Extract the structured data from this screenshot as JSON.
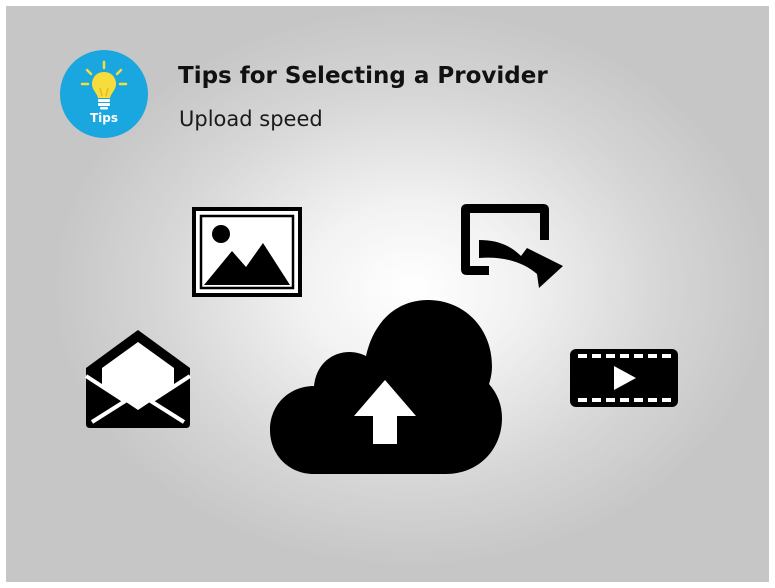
{
  "slide": {
    "badge_label": "Tips",
    "title": "Tips for Selecting a Provider",
    "subtitle": "Upload speed"
  },
  "icons": [
    "lightbulb-icon",
    "image-icon",
    "share-screen-icon",
    "envelope-icon",
    "cloud-upload-icon",
    "video-icon"
  ],
  "colors": {
    "badge": "#1aa6de",
    "bulb": "#f6dd3c",
    "icon": "#000000"
  }
}
